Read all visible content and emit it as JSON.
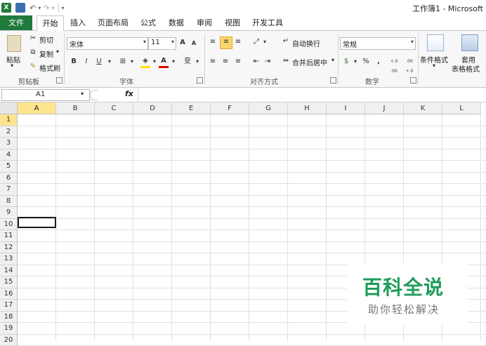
{
  "window": {
    "title": "工作簿1 - Microsoft"
  },
  "tabs": [
    "文件",
    "开始",
    "插入",
    "页面布局",
    "公式",
    "数据",
    "审阅",
    "视图",
    "开发工具"
  ],
  "ribbon": {
    "clipboard": {
      "label": "剪贴板",
      "paste": "粘贴",
      "cut": "剪切",
      "copy": "复制",
      "format_painter": "格式刷"
    },
    "font": {
      "label": "字体",
      "name": "宋体",
      "size": "11",
      "bold": "B",
      "italic": "I",
      "underline": "U",
      "grow": "A",
      "shrink": "A",
      "wen": "变"
    },
    "alignment": {
      "label": "对齐方式",
      "wrap": "自动换行",
      "merge": "合并后居中"
    },
    "number": {
      "label": "数字",
      "format": "常规",
      "percent": "%",
      "comma": ",",
      "inc": "+.0 .00",
      "dec": ".00 +.0"
    },
    "styles": {
      "conditional": "条件格式",
      "table_line1": "套用",
      "table_line2": "表格格式"
    }
  },
  "formula_bar": {
    "name_box": "A1",
    "fx": "fx",
    "value": ""
  },
  "grid": {
    "columns": [
      "A",
      "B",
      "C",
      "D",
      "E",
      "F",
      "G",
      "H",
      "I",
      "J",
      "K",
      "L"
    ],
    "rows": [
      "1",
      "2",
      "3",
      "4",
      "5",
      "6",
      "7",
      "8",
      "9",
      "10",
      "11",
      "12",
      "13",
      "14",
      "15",
      "16",
      "17",
      "18",
      "19",
      "20"
    ],
    "active_cell": "A1"
  },
  "watermark": {
    "title": "百科全说",
    "subtitle": "助你轻松解决"
  },
  "colors": {
    "file_tab": "#1f7a3b",
    "selection_header": "#fde58f",
    "watermark": "#1f9c5a"
  }
}
